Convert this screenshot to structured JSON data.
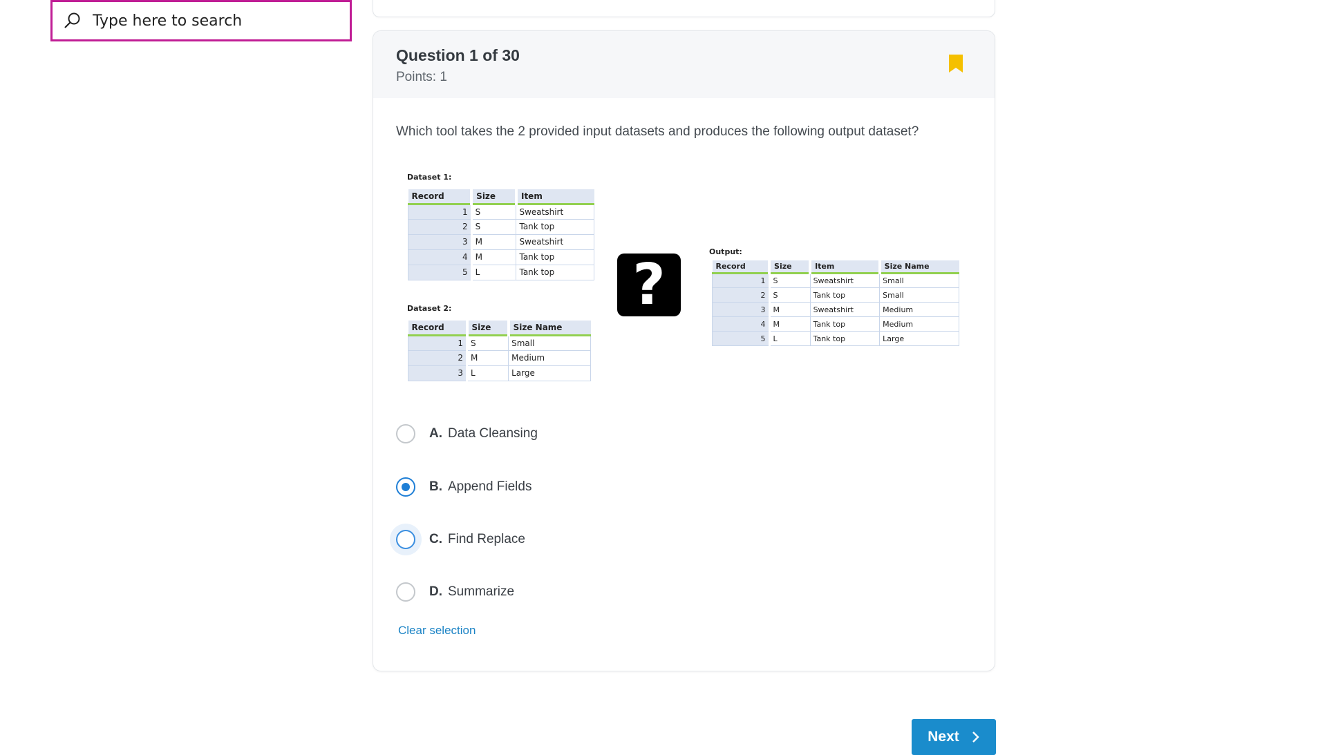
{
  "search": {
    "placeholder": "Type here to search",
    "value": ""
  },
  "question": {
    "title": "Question 1 of 30",
    "points": "Points: 1",
    "text": "Which tool takes the 2 provided input datasets and produces the following output dataset?",
    "bookmark_color": "#f5c000"
  },
  "figure": {
    "dataset1": {
      "label": "Dataset 1:",
      "headers": [
        "Record",
        "Size",
        "Item"
      ],
      "rows": [
        [
          "1",
          "S",
          "Sweatshirt"
        ],
        [
          "2",
          "S",
          "Tank top"
        ],
        [
          "3",
          "M",
          "Sweatshirt"
        ],
        [
          "4",
          "M",
          "Tank top"
        ],
        [
          "5",
          "L",
          "Tank top"
        ]
      ]
    },
    "dataset2": {
      "label": "Dataset 2:",
      "headers": [
        "Record",
        "Size",
        "Size Name"
      ],
      "rows": [
        [
          "1",
          "S",
          "Small"
        ],
        [
          "2",
          "M",
          "Medium"
        ],
        [
          "3",
          "L",
          "Large"
        ]
      ]
    },
    "output": {
      "label": "Output:",
      "headers": [
        "Record",
        "Size",
        "Item",
        "Size Name"
      ],
      "rows": [
        [
          "1",
          "S",
          "Sweatshirt",
          "Small"
        ],
        [
          "2",
          "S",
          "Tank top",
          "Small"
        ],
        [
          "3",
          "M",
          "Sweatshirt",
          "Medium"
        ],
        [
          "4",
          "M",
          "Tank top",
          "Medium"
        ],
        [
          "5",
          "L",
          "Tank top",
          "Large"
        ]
      ]
    },
    "unknown_symbol": "?"
  },
  "options": [
    {
      "letter": "A.",
      "text": "Data Cleansing",
      "state": "unchecked"
    },
    {
      "letter": "B.",
      "text": "Append Fields",
      "state": "checked"
    },
    {
      "letter": "C.",
      "text": "Find Replace",
      "state": "focused"
    },
    {
      "letter": "D.",
      "text": "Summarize",
      "state": "unchecked"
    }
  ],
  "clear_selection": "Clear selection",
  "next_label": "Next",
  "colors": {
    "accent": "#1a8ccc",
    "search_border": "#c01d95",
    "radio_checked": "#1f7fd6"
  }
}
